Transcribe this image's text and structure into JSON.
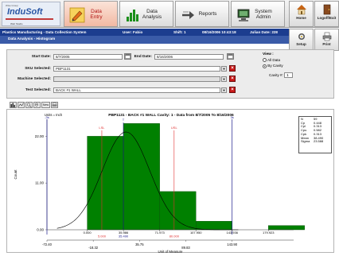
{
  "logo": {
    "small": "Wise Group",
    "name": "InduSoft",
    "tag": "Web Studio"
  },
  "nav": [
    {
      "id": "data-entry",
      "label_l1": "Data",
      "label_l2": "Entry",
      "active": true
    },
    {
      "id": "data-analysis",
      "label_l1": "Data",
      "label_l2": "Analysis",
      "active": false
    },
    {
      "id": "reports",
      "label_l1": "Reports",
      "label_l2": "",
      "active": false
    },
    {
      "id": "system-admin",
      "label_l1": "System",
      "label_l2": "Admin",
      "active": false
    }
  ],
  "right_buttons": {
    "home": "Home",
    "logoff": "Logoff/Exit",
    "setup": "Setup",
    "print": "Print"
  },
  "status": {
    "system": "Plastics Manufacturing - Data Collection System",
    "user": "User: Fabio",
    "shift": "Shift: 1",
    "datetime": "08/16/2006 10:43:18",
    "julian": "Julian Date: 228"
  },
  "breadcrumb": "Data Analysis - Histogram",
  "filters": {
    "start_label": "Start Date:",
    "start_value": "8/7/2005",
    "end_label": "End Date:",
    "end_value": "8/16/2006",
    "sku_label": "SKU Selected:",
    "sku_value": "PBP1131",
    "machine_label": "Machine Selected:",
    "machine_value": "",
    "test_label": "Test Selected:",
    "test_value": "BACK #1 WALL",
    "view_label": "View :",
    "view_all": "All Data",
    "view_cavity": "By Cavity",
    "view_selected": "By Cavity",
    "cavity_label": "Cavity #:",
    "cavity_value": "1"
  },
  "toolbar": {
    "new_label": "New"
  },
  "colors": {
    "bar": "#008000",
    "curve": "#000000",
    "limit": "#e03030",
    "sigma": "#1c1c8c",
    "navy": "#1c3d8f"
  },
  "chart_data": {
    "type": "bar",
    "title": "PBP1131 - BACK #1 WALL Cavity: 1 - Data from 8/7/2005 To 8/16/2006",
    "units_label": "Units = Inch",
    "xlabel": "Unit of Measure",
    "ylabel": "Count",
    "ylim": [
      0,
      26
    ],
    "yticks": [
      0,
      11,
      22
    ],
    "ytick_labels": [
      "0.00",
      "11.00",
      "22.00"
    ],
    "xlim": [
      -40,
      205
    ],
    "bin_edges": [
      0.0,
      35.98,
      71.97,
      107.95,
      143.93,
      179.92
    ],
    "values": [
      22,
      25,
      9,
      2,
      0,
      1
    ],
    "top_tick_labels": [
      "0.000",
      "35.986",
      "71.973",
      "107.950",
      "143.936",
      "179.923"
    ],
    "bottom_tick_values": [
      -72.4,
      -18.32,
      35.75,
      89.83,
      143.9
    ],
    "bottom_tick_labels": [
      "-72.40",
      "-18.32",
      "35.75",
      "89.83",
      "143.90"
    ],
    "limit_lines": [
      {
        "label": "LSL",
        "x": 14.5
      },
      {
        "label": "USL",
        "x": 86.3
      }
    ],
    "sigma_lines": [
      {
        "label": "-3s",
        "x": -40
      },
      {
        "label": "3s",
        "x": 143.9
      }
    ],
    "target_marker": {
      "label": "T",
      "x": 35.9
    },
    "limit_value_labels": [
      {
        "text": "5.000",
        "x": 14.5
      },
      {
        "text": "35.490",
        "x": 35.9
      },
      {
        "text": "80.000",
        "x": 86.3
      }
    ],
    "curve": {
      "mean": 38.49,
      "sigma": 23.59,
      "peak": 23
    },
    "grid": false,
    "legend": "none"
  },
  "stats": [
    {
      "k": "N",
      "v": "59"
    },
    {
      "k": "Cp",
      "v": "0.448"
    },
    {
      "k": "Cpl",
      "v": "0.313"
    },
    {
      "k": "Cpu",
      "v": "0.582"
    },
    {
      "k": "Cpk",
      "v": "0.313"
    },
    {
      "k": "Mean",
      "v": "38.490"
    },
    {
      "k": "Sigma",
      "v": "23.588"
    }
  ]
}
